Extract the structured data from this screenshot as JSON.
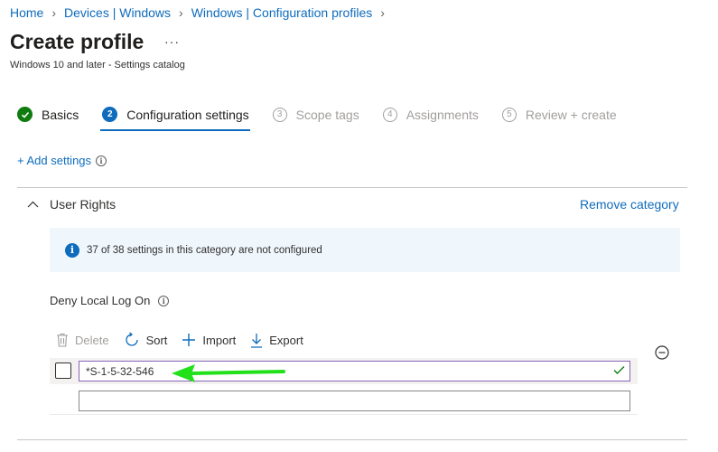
{
  "breadcrumb": {
    "items": [
      "Home",
      "Devices | Windows",
      "Windows | Configuration profiles"
    ],
    "separator": ">"
  },
  "header": {
    "title": "Create profile",
    "more_label": "···",
    "subtitle": "Windows 10 and later - Settings catalog"
  },
  "wizard": {
    "steps": [
      {
        "number": "✓",
        "label": "Basics",
        "state": "done"
      },
      {
        "number": "2",
        "label": "Configuration settings",
        "state": "active"
      },
      {
        "number": "3",
        "label": "Scope tags",
        "state": "pending"
      },
      {
        "number": "4",
        "label": "Assignments",
        "state": "pending"
      },
      {
        "number": "5",
        "label": "Review + create",
        "state": "pending"
      }
    ]
  },
  "add_settings": {
    "label": "+ Add settings",
    "info_icon": "info-icon"
  },
  "category": {
    "name": "User Rights",
    "remove_label": "Remove category",
    "info_text": "37 of 38 settings in this category are not configured"
  },
  "setting": {
    "label": "Deny Local Log On",
    "toolbar": {
      "delete_label": "Delete",
      "sort_label": "Sort",
      "import_label": "Import",
      "export_label": "Export"
    },
    "rows": [
      {
        "value": "*S-1-5-32-546",
        "valid": true
      },
      {
        "value": ""
      }
    ]
  },
  "colors": {
    "accent": "#0f6cbd",
    "success": "#107c10",
    "annotation_arrow": "#22e01a",
    "input_focus": "#8764b8"
  }
}
